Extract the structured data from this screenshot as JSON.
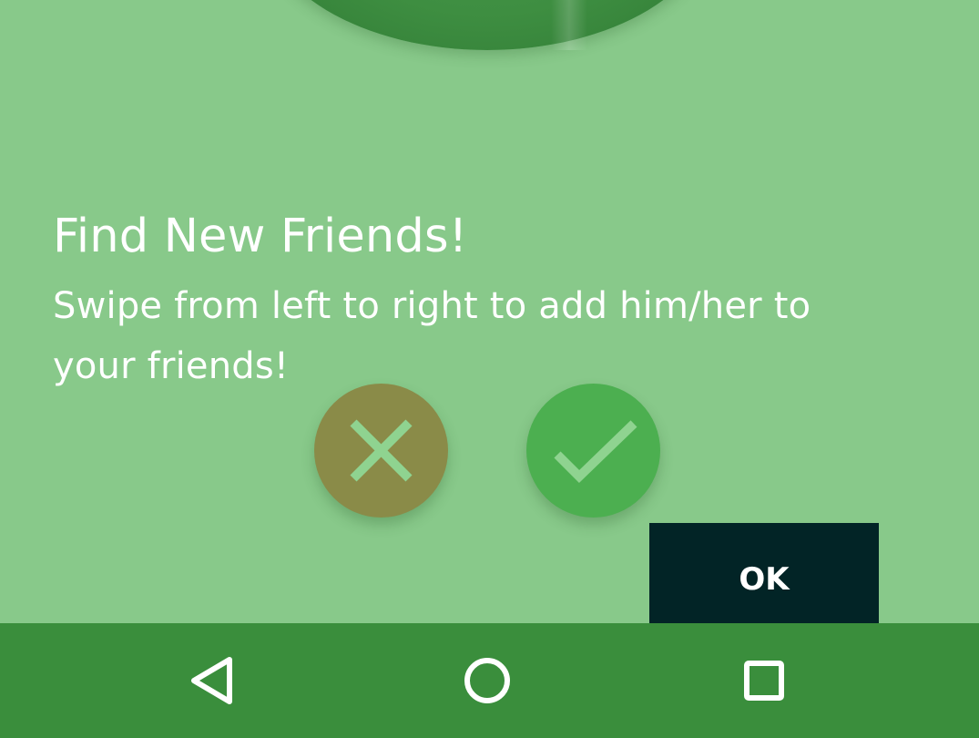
{
  "onboarding": {
    "title": "Find New Friends!",
    "description": "Swipe from left to right to add him/her to your friends!"
  },
  "actions": {
    "reject_icon": "close-icon",
    "accept_icon": "check-icon",
    "ok_label": "OK"
  },
  "navbar": {
    "back_icon": "back-triangle-icon",
    "home_icon": "home-circle-icon",
    "recents_icon": "recents-square-icon"
  },
  "colors": {
    "overlay": "#88c98a",
    "reject": "#8a8b48",
    "accept": "#4caf50",
    "ok_button": "#022426",
    "navbar": "#3a8e3c"
  }
}
